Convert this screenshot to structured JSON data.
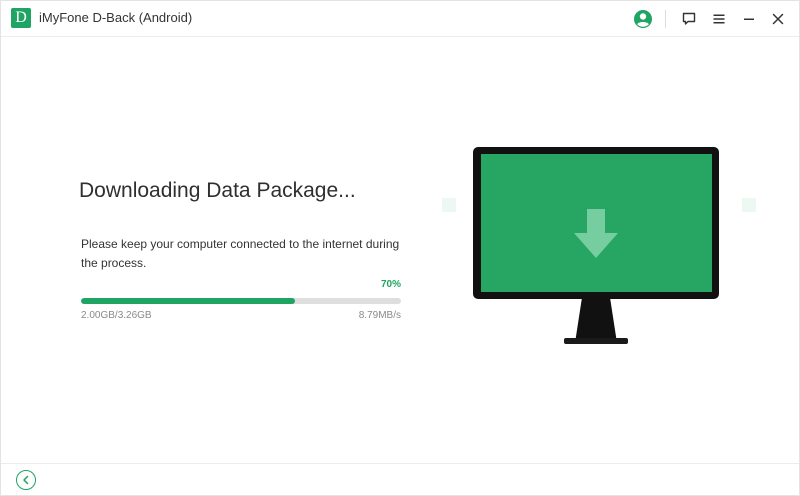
{
  "window": {
    "app_logo_letter": "D",
    "title": "iMyFone D-Back (Android)",
    "controls": {
      "account_icon": "user-circle-icon",
      "feedback_icon": "chat-bubble-icon",
      "menu_icon": "hamburger-menu-icon",
      "minimize_icon": "minimize-icon",
      "close_icon": "close-icon"
    }
  },
  "main": {
    "title": "Downloading Data Package...",
    "description": "Please keep your computer connected to the internet during the process.",
    "progress": {
      "percent_label": "70%",
      "fraction": 0.67,
      "size_text": "2.00GB/3.26GB",
      "speed_text": "8.79MB/s"
    }
  },
  "illustration": {
    "icon": "download-arrow-icon",
    "device": "monitor-icon"
  },
  "footer": {
    "back_icon": "back-arrow-icon"
  },
  "colors": {
    "accent": "#1fa463",
    "screen": "#27a563",
    "monitor_frame": "#111111",
    "progress_track": "#dedede",
    "title_text": "#2f2f2f",
    "muted_text": "#8a8a8a"
  }
}
